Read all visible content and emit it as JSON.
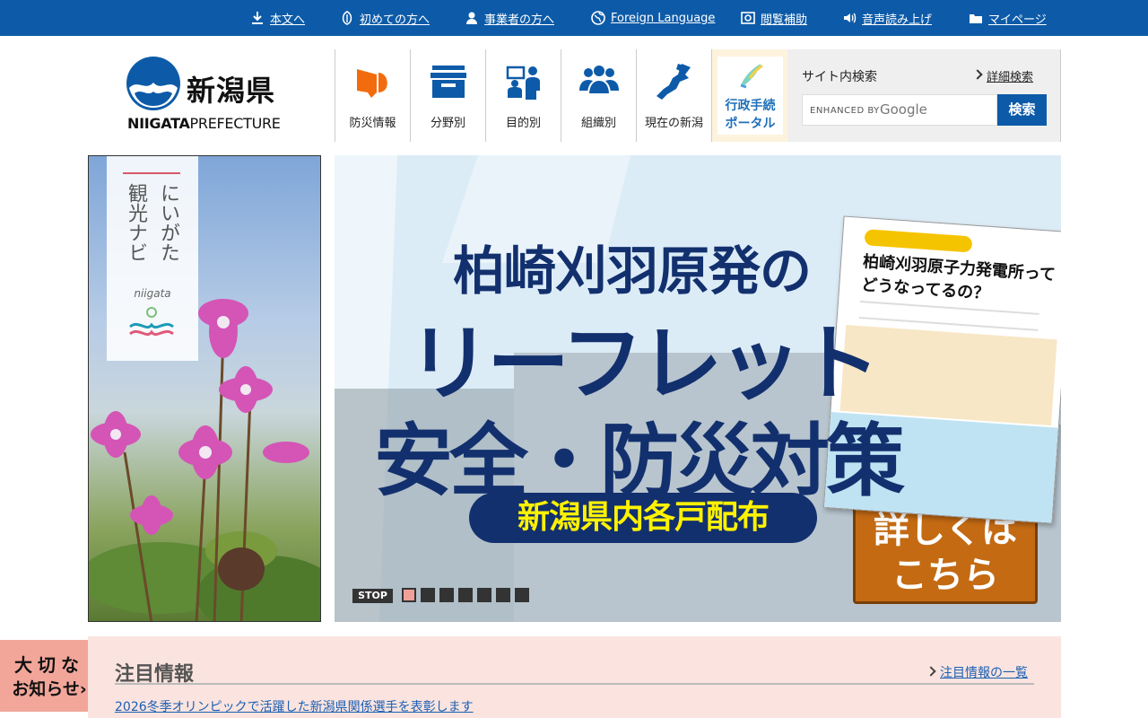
{
  "topbar": {
    "items": [
      {
        "label": "本文へ",
        "icon": "download-arrow-icon"
      },
      {
        "label": "初めての方へ",
        "icon": "shield-leaf-icon"
      },
      {
        "label": "事業者の方へ",
        "icon": "person-icon"
      },
      {
        "label": "Foreign Language",
        "icon": "globe-icon"
      },
      {
        "label": "閲覧補助",
        "icon": "settings-box-icon"
      },
      {
        "label": "音声読み上げ",
        "icon": "speaker-icon"
      },
      {
        "label": "マイページ",
        "icon": "folder-icon"
      }
    ]
  },
  "logo": {
    "name_ja": "新潟県",
    "name_en_bold": "NIIGATA",
    "name_en_rest": "PREFECTURE"
  },
  "nav": {
    "items": [
      {
        "label": "防災情報",
        "icon": "megaphone-icon"
      },
      {
        "label": "分野別",
        "icon": "file-box-icon"
      },
      {
        "label": "目的別",
        "icon": "presenter-icon"
      },
      {
        "label": "組織別",
        "icon": "group-icon"
      },
      {
        "label": "現在の新潟",
        "icon": "niigata-map-icon"
      }
    ],
    "portal": {
      "line1": "行政手続",
      "line2": "ポータル"
    }
  },
  "search": {
    "label": "サイト内検索",
    "advanced": "詳細検索",
    "enhanced": "ENHANCED BY",
    "google": "Google",
    "button": "検索"
  },
  "tourism": {
    "col1": "にいがた",
    "col2": "観光ナビ",
    "sub": "niigata"
  },
  "slider": {
    "headline1": "柏崎刈羽原発の",
    "headline2": "リーフレット",
    "headline3": "安全・防災対策",
    "pill": "新潟県内各戸配布",
    "leaflet_title1": "柏崎刈羽原子力発電所って",
    "leaflet_title2": "どうなってるの？",
    "more_line1": "詳しくは",
    "more_line2": "こちら",
    "stop": "STOP",
    "slide_count": 7,
    "active_slide": 1
  },
  "notice": {
    "line1": "大切な",
    "line2": "お知らせ›"
  },
  "featured": {
    "title": "注目情報",
    "more": "注目情報の一覧",
    "news": [
      "2026冬季オリンピックで活躍した新潟県関係選手を表彰します"
    ]
  },
  "colors": {
    "brand_blue": "#0d5ba8",
    "navy": "#13306e",
    "accent_orange": "#c36a13",
    "notice_pink": "#f2a69a"
  }
}
